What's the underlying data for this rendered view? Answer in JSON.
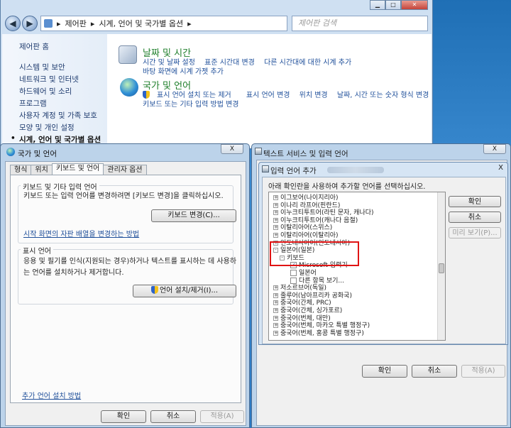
{
  "control_panel": {
    "address": {
      "root": "제어판",
      "current": "시계, 언어 및 국가별 옵션"
    },
    "search_placeholder": "제어판 검색",
    "sidebar": [
      "제어판 홈",
      "시스템 및 보안",
      "네트워크 및 인터넷",
      "하드웨어 및 소리",
      "프로그램",
      "사용자 계정 및 가족 보호",
      "모양 및 개인 설정",
      "시계, 언어 및 국가별 옵션"
    ],
    "categories": [
      {
        "title": "날짜 및 시간",
        "links_row1": [
          "시간 및 날짜 설정",
          "표준 시간대 변경",
          "다른 시간대에 대한 시계 추가"
        ],
        "links_row2": [
          "바탕 화면에 시계 가젯 추가"
        ]
      },
      {
        "title": "국가 및 언어",
        "links_row1": [
          "키보드 또는 기타 입력 방법 변경",
          "표시 언어 변경",
          "위치 변경",
          "날짜, 시간 또는 숫자 형식 변경"
        ],
        "links_row1_first": "표시 언어 설치 또는 제거",
        "links_row2": [
          "키보드 또는 기타 입력 방법 변경"
        ]
      }
    ]
  },
  "region_dialog": {
    "title": "국가 및 언어",
    "close": "X",
    "tabs": [
      "형식",
      "위치",
      "키보드 및 언어",
      "관리자 옵션"
    ],
    "keyboard_group": {
      "label": "키보드 및 기타 입력 언어",
      "text": "키보드 또는 입력 언어를 변경하려면 [키보드 변경]을 클릭하십시오.",
      "button": "키보드 변경(C)...",
      "link": "시작 화면의 자판 배열을 변경하는 방법"
    },
    "display_group": {
      "label": "표시 언어",
      "text1": "응용 및 필기를 인식(지원되는 경우)하거나 텍스트를 표시하는 데 사용하",
      "text2": "는 언어를 설치하거나 제거합니다.",
      "button": "언어 설치/제거(I)..."
    },
    "footer_link": "추가 언어 설치 방법",
    "ok": "확인",
    "cancel": "취소",
    "apply": "적용(A)"
  },
  "text_services_dialog": {
    "title": "텍스트 서비스 및 입력 언어",
    "close": "X",
    "ok": "확인",
    "cancel": "취소",
    "apply": "적용(A)"
  },
  "add_language_dialog": {
    "title": "입력 언어 추가",
    "close": "X",
    "prompt": "아래 확인란을 사용하여 추가할 언어를 선택하십시오.",
    "ok": "확인",
    "cancel": "취소",
    "preview": "미리 보기(P)...",
    "tree": [
      {
        "label": "이그보어(나이지리아)",
        "expander": "+"
      },
      {
        "label": "이나리 라프어(핀란드)",
        "expander": "+"
      },
      {
        "label": "이누크티투트어(라틴 문자, 캐나다)",
        "expander": "+"
      },
      {
        "label": "이누크티투트어(캐나다 음절)",
        "expander": "+"
      },
      {
        "label": "이탈리아어(스위스)",
        "expander": "+"
      },
      {
        "label": "이탈리아어(이탈리아)",
        "expander": "+"
      },
      {
        "label": "인도네시아어(인도네시아)",
        "expander": "+"
      },
      {
        "label": "일본어(일본)",
        "expander": "-"
      },
      {
        "label": "키보드",
        "expander": "-",
        "level": 1
      },
      {
        "label": "Microsoft 입력기",
        "checked": true,
        "level": 2
      },
      {
        "label": "일본어",
        "checked": false,
        "level": 2
      },
      {
        "label": "다른 항목 보기...",
        "checked": false,
        "level": 2
      },
      {
        "label": "저소르브어(독일)",
        "expander": "+"
      },
      {
        "label": "줄루어(남아프리카 공화국)",
        "expander": "+"
      },
      {
        "label": "중국어(간체, PRC)",
        "expander": "+"
      },
      {
        "label": "중국어(간체, 싱가포르)",
        "expander": "+"
      },
      {
        "label": "중국어(번체, 대만)",
        "expander": "+"
      },
      {
        "label": "중국어(번체, 마카오 특별 행정구)",
        "expander": "+"
      },
      {
        "label": "중국어(번체, 홍콩 특별 행정구)",
        "expander": "+"
      }
    ]
  }
}
